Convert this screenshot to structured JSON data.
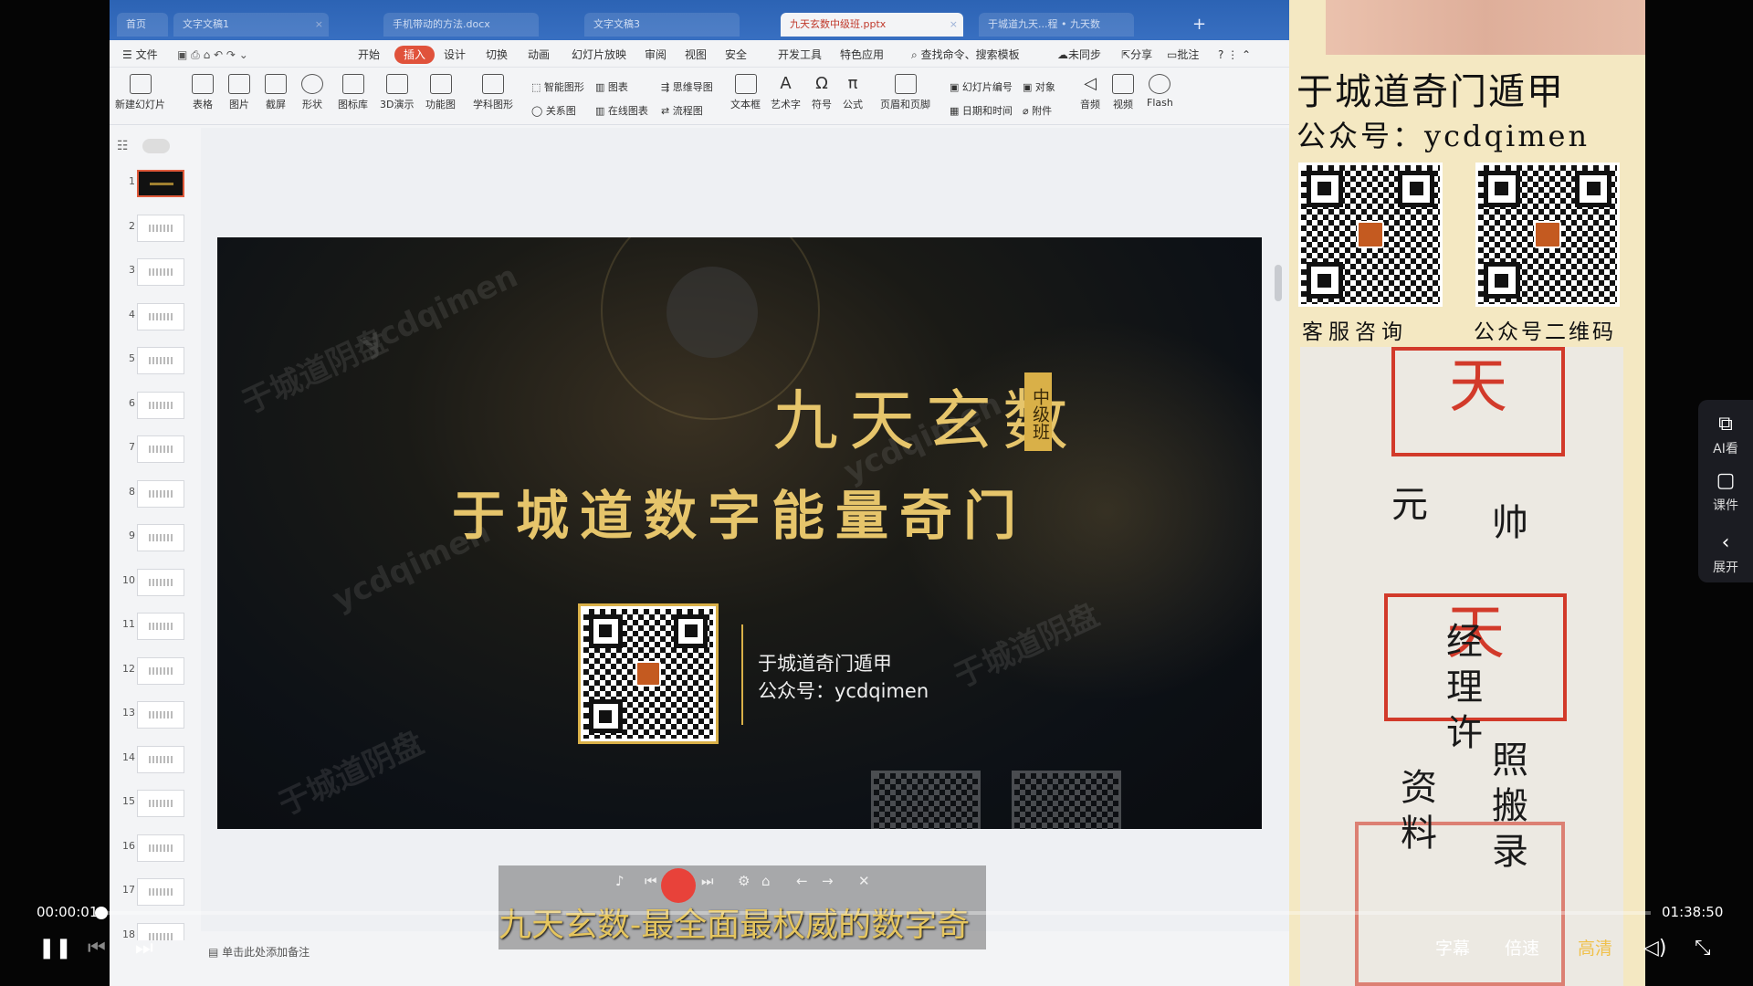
{
  "tabs": [
    {
      "label": "首页",
      "active": false
    },
    {
      "label": "文字文稿1",
      "active": false
    },
    {
      "label": "手机带动的方法.docx",
      "active": false
    },
    {
      "label": "文字文稿3",
      "active": false
    },
    {
      "label": "九天玄数中级班.pptx",
      "active": true
    },
    {
      "label": "于城道九天...程 • 九天数",
      "active": false
    }
  ],
  "menu": {
    "file": "文件",
    "items": [
      "开始",
      "插入",
      "设计",
      "切换",
      "动画",
      "幻灯片放映",
      "审阅",
      "视图",
      "安全",
      "开发工具",
      "特色应用"
    ],
    "active": "插入",
    "search": "查找命令、搜索模板",
    "sync": "未同步",
    "share": "分享",
    "comment": "批注"
  },
  "ribbon": {
    "new_slide": "新建幻灯片",
    "table": "表格",
    "picture": "图片",
    "screenshot": "截屏",
    "shape": "形状",
    "icon_lib": "图标库",
    "demo3d": "3D演示",
    "func_chart": "功能图",
    "subject_chart": "学科图形",
    "smart_shape": "智能图形",
    "chart": "图表",
    "mindmap": "思维导图",
    "relation": "关系图",
    "online_chart": "在线图表",
    "flowchart": "流程图",
    "textbox": "文本框",
    "wordart": "艺术字",
    "symbol": "符号",
    "formula": "公式",
    "header_footer": "页眉和页脚",
    "slide_num": "幻灯片编号",
    "object": "对象",
    "datetime": "日期和时间",
    "attachment": "附件",
    "audio": "音频",
    "video": "视频",
    "flash": "Flash"
  },
  "thumbs": [
    "1",
    "2",
    "3",
    "4",
    "5",
    "6",
    "7",
    "8",
    "9",
    "10",
    "11",
    "12",
    "13",
    "14",
    "15",
    "16",
    "17",
    "18"
  ],
  "slide": {
    "title": "九天玄数",
    "badge": "中级班",
    "subtitle": "于城道数字能量奇门",
    "info_line1": "于城道奇门遁甲",
    "info_line2": "公众号：ycdqimen",
    "watermark1": "于城道阴盘",
    "watermark2": "ycdqimen"
  },
  "notes_placeholder": "单击此处添加备注",
  "caption": "九天玄数-最全面最权威的数字奇",
  "right_panel": {
    "title": "于城道奇门遁甲",
    "account": "公众号：ycdqimen",
    "qr1_caption": "客服咨询",
    "qr2_caption": "公众号二维码",
    "handwriting": [
      "天",
      "元",
      "帅",
      "经",
      "理",
      "许",
      "照",
      "搬",
      "资",
      "料",
      "录"
    ]
  },
  "side_buttons": {
    "ai": "AI看",
    "courseware": "课件",
    "expand": "展开"
  },
  "player": {
    "current_time": "00:00:01",
    "total_time": "01:38:50",
    "progress": 0.0002,
    "subtitle_btn": "字幕",
    "speed_btn": "倍速",
    "quality_btn": "高清"
  }
}
